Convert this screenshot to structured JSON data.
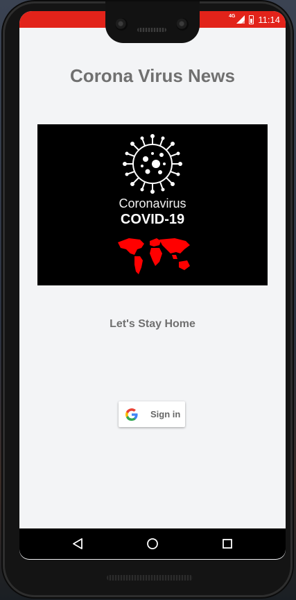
{
  "status": {
    "network": "4G",
    "time": "11:14"
  },
  "page": {
    "title": "Corona Virus News",
    "subtitle": "Let's Stay Home"
  },
  "hero_image": {
    "caption_line1": "Coronavirus",
    "caption_line2": "COVID-19",
    "icons": [
      "virus-icon",
      "world-map-icon"
    ]
  },
  "signin_button": {
    "label": "Sign in",
    "icon": "google-g-icon"
  },
  "navigation": {
    "items": [
      "back-icon",
      "home-icon",
      "recent-apps-icon"
    ]
  },
  "colors": {
    "statusbar": "#e2231a",
    "screen_bg": "#f3f4f6",
    "text_gray": "#707070",
    "hero_bg": "#000000",
    "map_red": "#ff0000"
  }
}
